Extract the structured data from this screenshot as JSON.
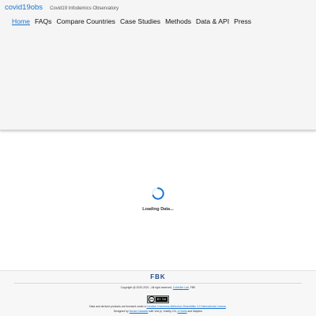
{
  "header": {
    "brand": "covid19obs",
    "subtitle": "Covid19 Infodemics Observatory",
    "nav": [
      {
        "label": "Home",
        "active": true
      },
      {
        "label": "FAQs"
      },
      {
        "label": "Compare Countries"
      },
      {
        "label": "Case Studies"
      },
      {
        "label": "Methods"
      },
      {
        "label": "Data & API"
      },
      {
        "label": "Press"
      }
    ]
  },
  "main": {
    "loading_text": "Loading Data..."
  },
  "footer": {
    "logo_text": "FBK",
    "copyright_prefix": "Copyright @ 2020-2021 - All right reserved,",
    "copyright_link": "CoMuNe Lab",
    "copyright_suffix": ", FBK",
    "cc_badge": "BY SA",
    "license_prefix": "Data and derived products are licensed under a",
    "license_link": "Creative Commons Attribution-ShareAlike 4.0 International License",
    "license_suffix": ".",
    "designed_prefix": "Designed by",
    "designed_link": "Nicola Castaldo",
    "designed_middle": "with Vue.js, Vuetify, D3,",
    "designed_link2": "eCharts",
    "designed_suffix": "and Mapbox"
  },
  "colors": {
    "accent": "#1976d2",
    "header_bg": "#f5f5f5",
    "footer_bg": "#f7f7f7"
  },
  "icons": {
    "spinner": "loading-spinner-icon",
    "logo": "fbk-logo-icon",
    "license": "cc-by-sa-icon"
  }
}
